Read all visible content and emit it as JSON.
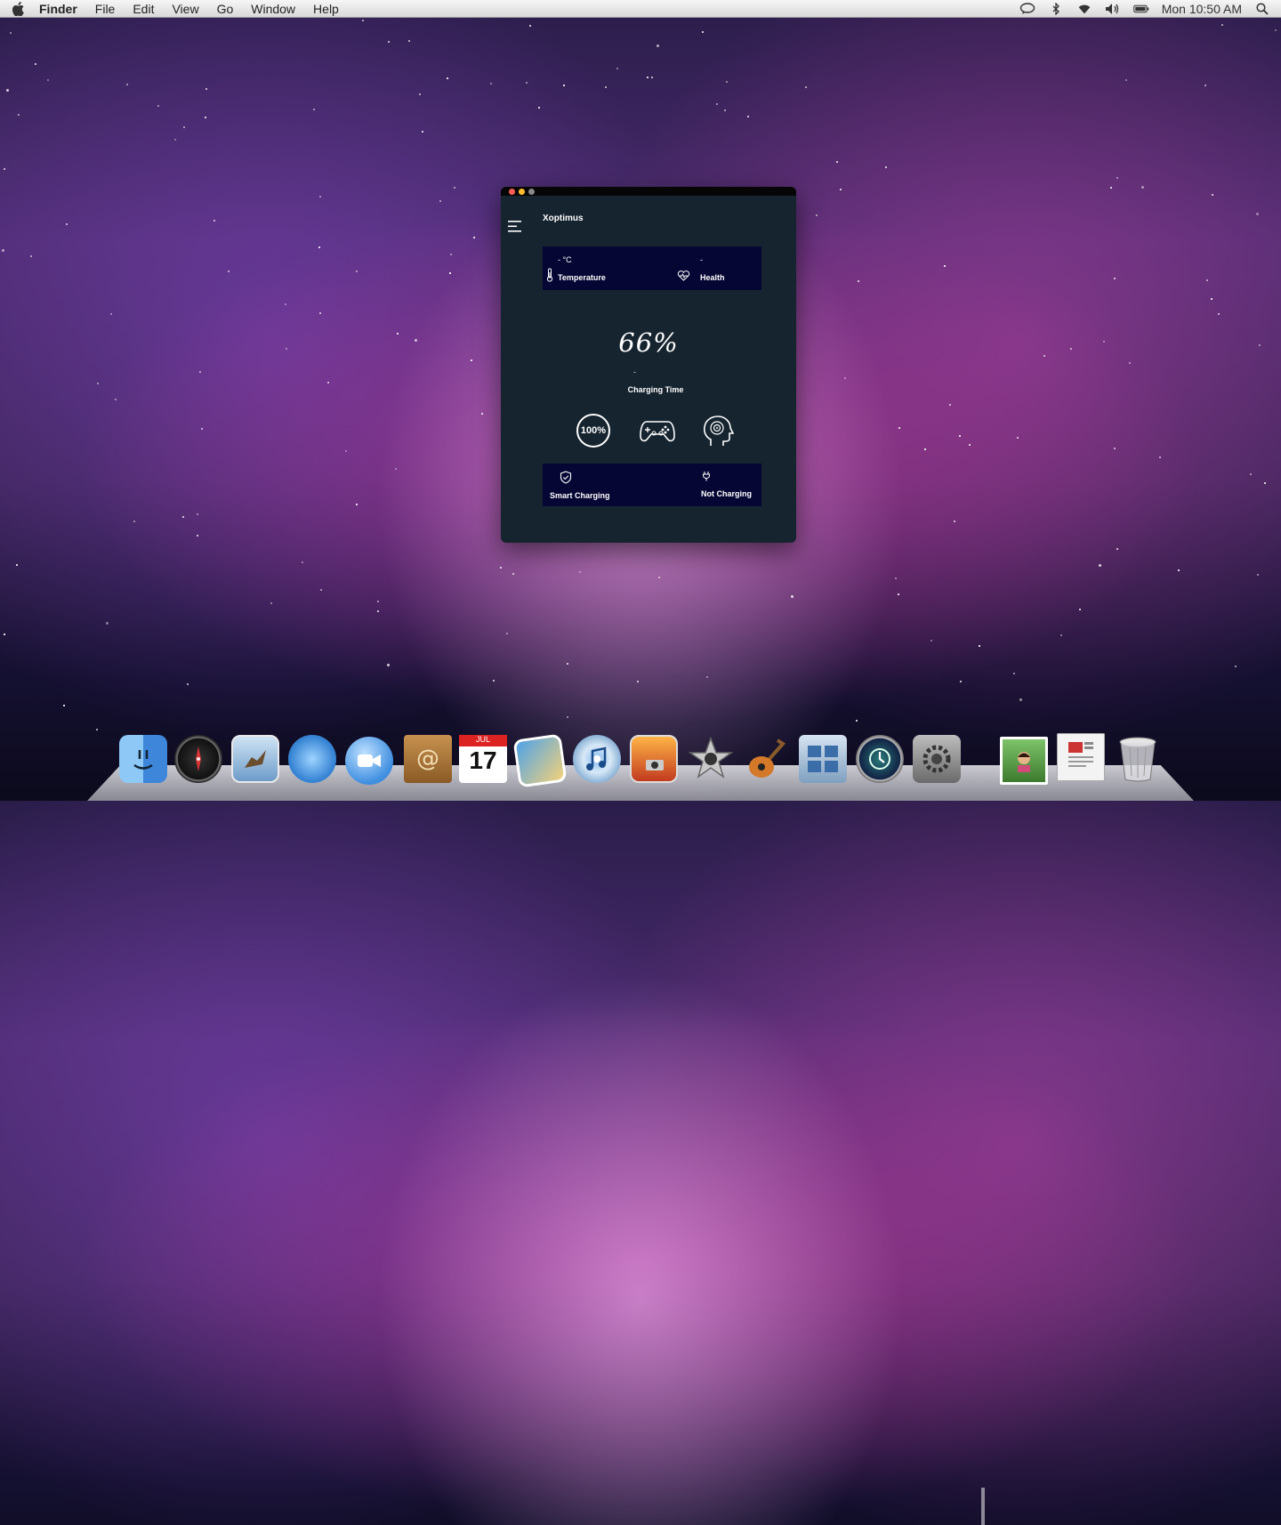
{
  "menubar": {
    "app_name": "Finder",
    "items": [
      "File",
      "Edit",
      "View",
      "Go",
      "Window",
      "Help"
    ],
    "clock": "Mon 10:50 AM",
    "status_icons": [
      "chat-icon",
      "bluetooth-icon",
      "wifi-icon",
      "volume-icon",
      "battery-icon",
      "spotlight-search-icon"
    ]
  },
  "window": {
    "title": "Xoptimus",
    "traffic_lights": [
      "#ff5f57",
      "#febc2e",
      "#8a8a8a"
    ],
    "stats": {
      "temperature_value": "- °C",
      "temperature_label": "Temperature",
      "health_value": "-",
      "health_label": "Health"
    },
    "battery_percent": "66%",
    "charging_time_value": "-",
    "charging_time_label": "Charging Time",
    "modes": {
      "full_charge_label": "100%",
      "icons": [
        "full-charge-mode-icon",
        "gaming-mode-icon",
        "smart-mode-icon"
      ]
    },
    "bottom": {
      "smart_charging_label": "Smart Charging",
      "charging_status_label": "Not Charging"
    }
  },
  "dock": {
    "apps": [
      "finder",
      "dashboard",
      "mail",
      "safari",
      "ichat",
      "address-book",
      "ical",
      "iphoto",
      "itunes",
      "photo-booth",
      "imovie",
      "garageband",
      "spaces",
      "time-machine",
      "system-preferences",
      "photos-stack",
      "documents-stack",
      "trash"
    ],
    "ical_date": "17",
    "ical_month": "JUL"
  },
  "colors": {
    "window_bg": "#16242f",
    "card_bg": "#050634",
    "menubar_bg": "#e9e9e9"
  }
}
